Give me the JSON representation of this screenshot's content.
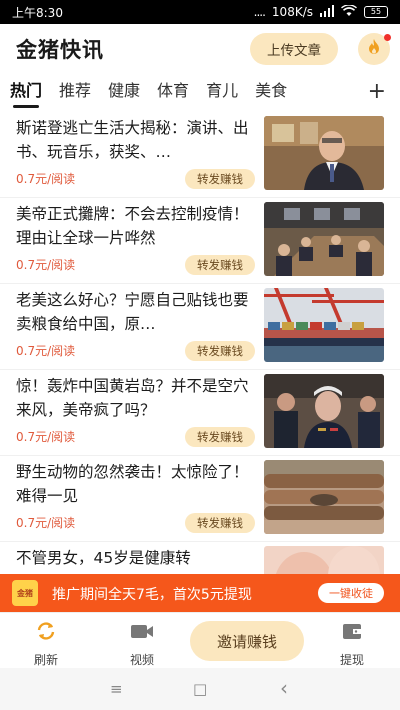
{
  "status_bar": {
    "time": "上午8:30",
    "signal": "....",
    "speed": "108K/s",
    "battery": "55"
  },
  "header": {
    "title": "金猪快讯",
    "upload_label": "上传文章"
  },
  "tabs": [
    {
      "label": "热门"
    },
    {
      "label": "推荐"
    },
    {
      "label": "健康"
    },
    {
      "label": "体育"
    },
    {
      "label": "育儿"
    },
    {
      "label": "美食"
    }
  ],
  "tab_add_label": "+",
  "articles": [
    {
      "title": "斯诺登逃亡生活大揭秘：演讲、出书、玩音乐，获奖、…",
      "reward": "0.7元/阅读",
      "share_label": "转发赚钱",
      "thumb": "portrait"
    },
    {
      "title": "美帝正式攤牌：不会去控制疫情！理由让全球一片哗然",
      "reward": "0.7元/阅读",
      "share_label": "转发赚钱",
      "thumb": "meeting"
    },
    {
      "title": "老美这么好心？宁愿自己贴钱也要卖粮食给中国，原…",
      "reward": "0.7元/阅读",
      "share_label": "转发赚钱",
      "thumb": "port"
    },
    {
      "title": "惊！轰炸中国黄岩岛？并不是空穴来风，美帝疯了吗？",
      "reward": "0.7元/阅读",
      "share_label": "转发赚钱",
      "thumb": "officials"
    },
    {
      "title": "野生动物的忽然袭击！太惊险了！难得一见",
      "reward": "0.7元/阅读",
      "share_label": "转发赚钱",
      "thumb": "logs"
    },
    {
      "title": "不管男女，45岁是健康转",
      "reward": "",
      "share_label": "",
      "thumb": "skin"
    }
  ],
  "promo": {
    "coin_label": "金猪",
    "text": "推广期间全天7毛，首次5元提现",
    "button_label": "一键收徒"
  },
  "bottom_nav": {
    "refresh_label": "刷新",
    "video_label": "视频",
    "invite_label": "邀请赚钱",
    "withdraw_label": "提现"
  },
  "system_nav": {
    "menu": "≡",
    "home": "□",
    "back": "‹"
  },
  "colors": {
    "accent_light": "#fbe7bf",
    "reward_red": "#e05a3c",
    "promo_orange": "#f5571b"
  },
  "icons": [
    "signal-icon",
    "wifi-icon",
    "battery-icon",
    "fire-icon",
    "refresh-icon",
    "video-icon",
    "wallet-icon"
  ]
}
